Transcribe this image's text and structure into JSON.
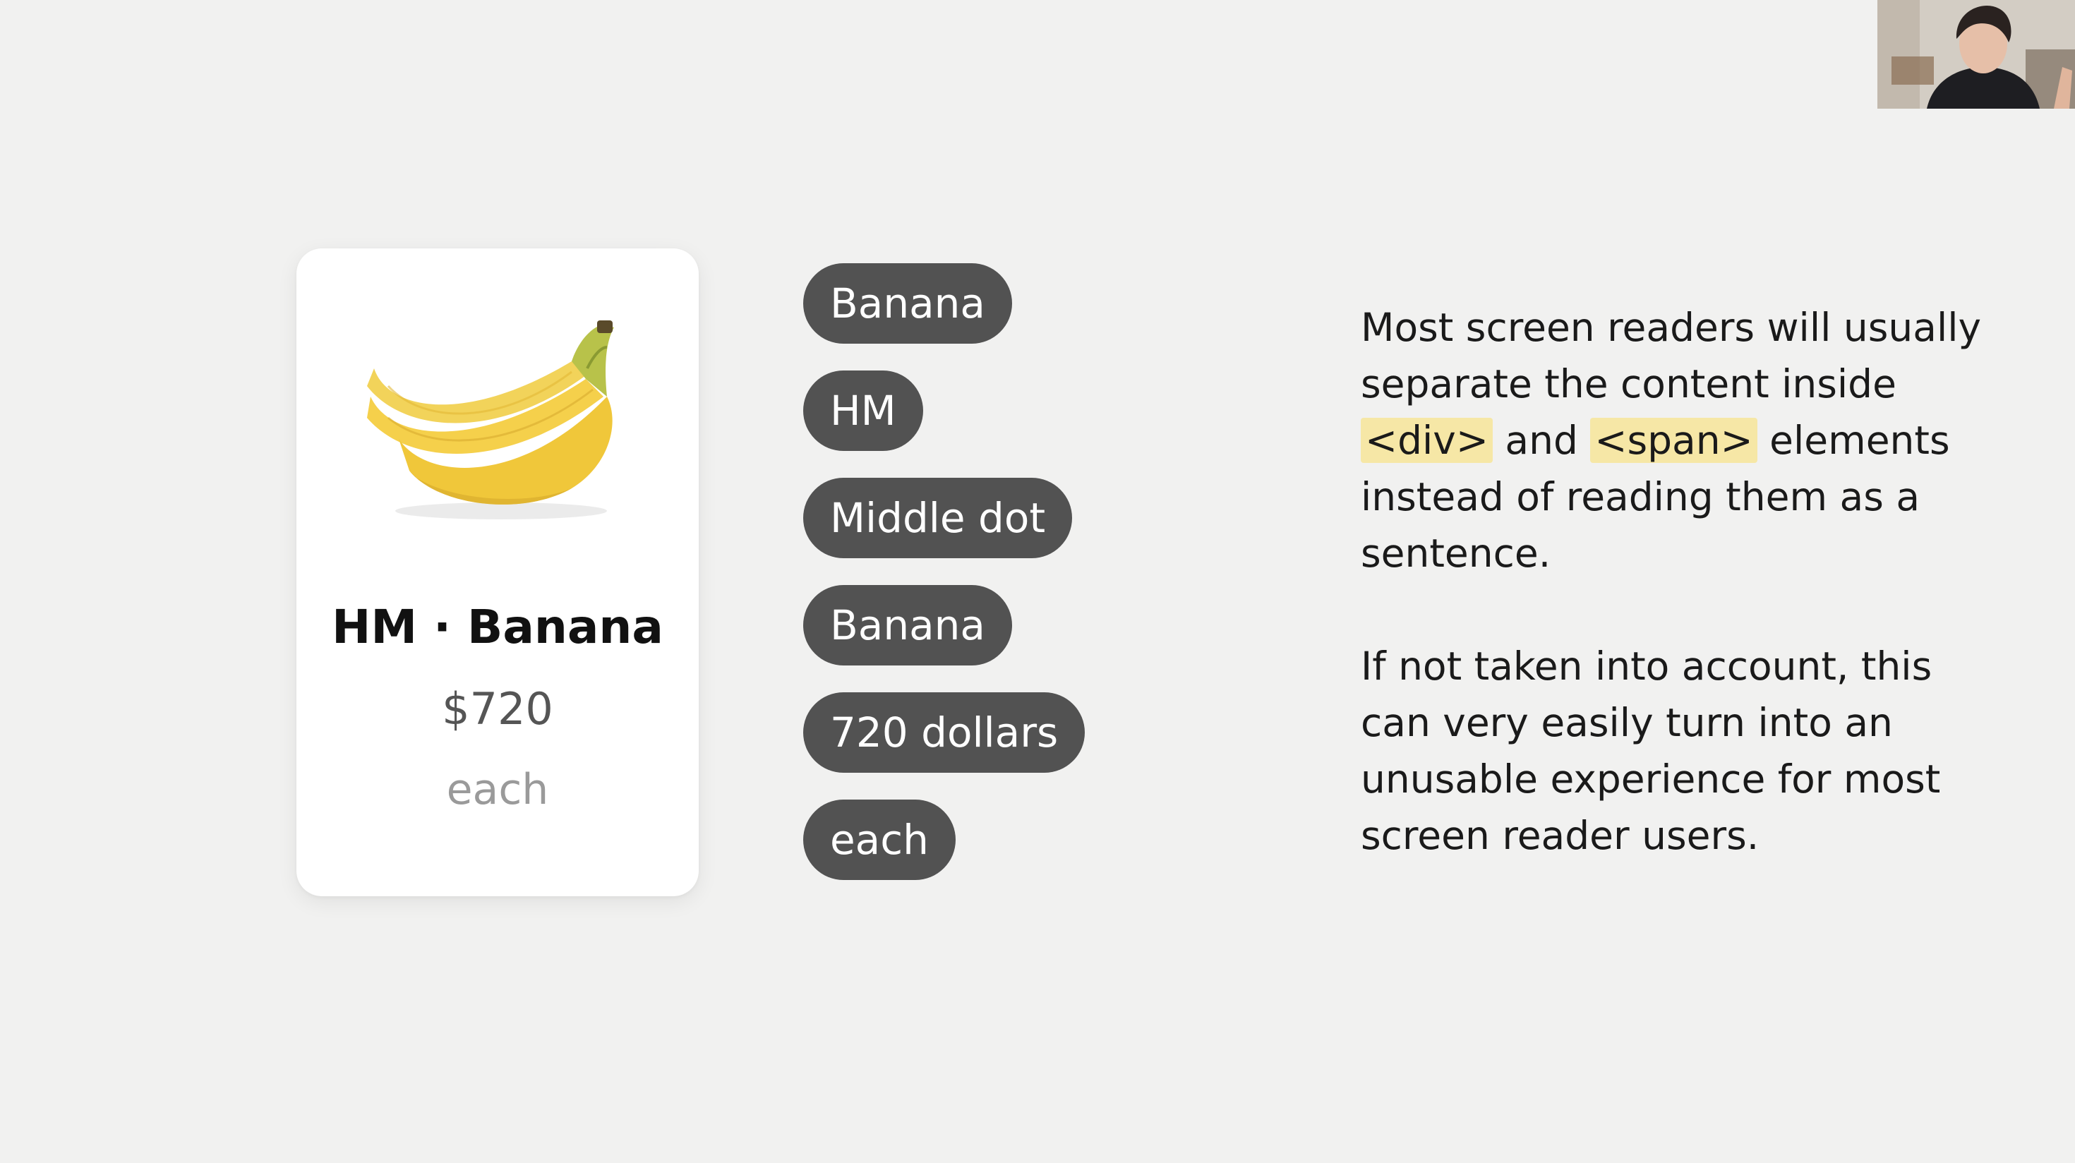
{
  "product_card": {
    "image_icon": "banana-bunch-icon",
    "title": "HM · Banana",
    "price": "$720",
    "unit": "each"
  },
  "screen_reader_output": [
    "Banana",
    "HM",
    "Middle dot",
    "Banana",
    "720 dollars",
    "each"
  ],
  "explanation": {
    "p1_before": "Most screen readers will usually separate the content inside",
    "p1_code1": "<div>",
    "p1_mid": "and",
    "p1_code2": "<span>",
    "p1_after": "elements instead of reading them as a sentence.",
    "p2": "If not taken into account, this can very easily turn into an unusable experience for most screen reader users."
  },
  "colors": {
    "background": "#f1f1f0",
    "chip": "#525252",
    "highlight": "#f6e7a6"
  },
  "webcam": {
    "icon": "presenter-video-icon"
  }
}
